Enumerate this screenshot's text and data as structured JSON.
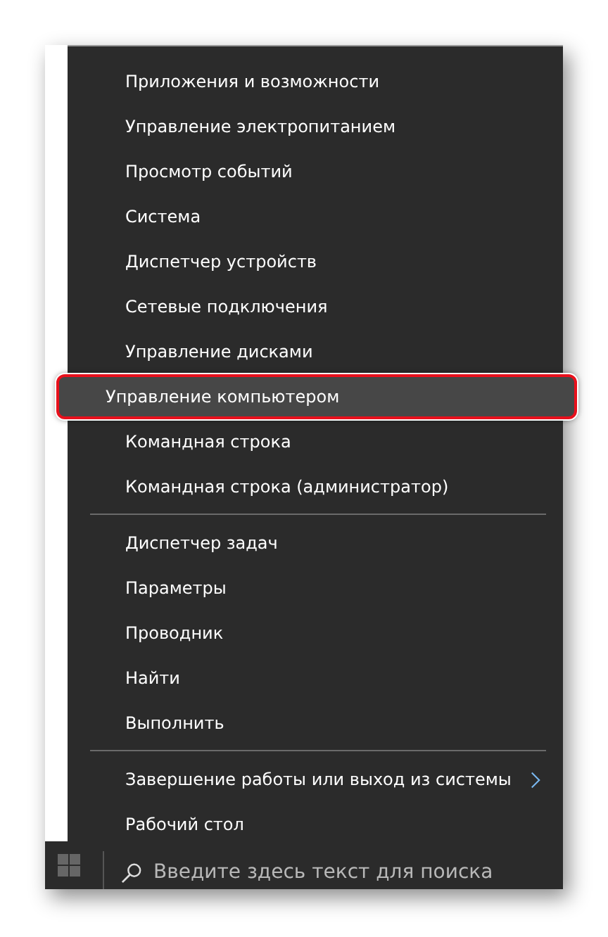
{
  "menu": {
    "groups": [
      {
        "items": [
          {
            "label": "Приложения и возможности",
            "selected": false,
            "has_submenu": false
          },
          {
            "label": "Управление электропитанием",
            "selected": false,
            "has_submenu": false
          },
          {
            "label": "Просмотр событий",
            "selected": false,
            "has_submenu": false
          },
          {
            "label": "Система",
            "selected": false,
            "has_submenu": false
          },
          {
            "label": "Диспетчер устройств",
            "selected": false,
            "has_submenu": false
          },
          {
            "label": "Сетевые подключения",
            "selected": false,
            "has_submenu": false
          },
          {
            "label": "Управление дисками",
            "selected": false,
            "has_submenu": false
          },
          {
            "label": "Управление компьютером",
            "selected": true,
            "has_submenu": false
          },
          {
            "label": "Командная строка",
            "selected": false,
            "has_submenu": false
          },
          {
            "label": "Командная строка (администратор)",
            "selected": false,
            "has_submenu": false
          }
        ]
      },
      {
        "items": [
          {
            "label": "Диспетчер задач",
            "selected": false,
            "has_submenu": false
          },
          {
            "label": "Параметры",
            "selected": false,
            "has_submenu": false
          },
          {
            "label": "Проводник",
            "selected": false,
            "has_submenu": false
          },
          {
            "label": "Найти",
            "selected": false,
            "has_submenu": false
          },
          {
            "label": "Выполнить",
            "selected": false,
            "has_submenu": false
          }
        ]
      },
      {
        "items": [
          {
            "label": "Завершение работы или выход из системы",
            "selected": false,
            "has_submenu": true
          },
          {
            "label": "Рабочий стол",
            "selected": false,
            "has_submenu": false
          }
        ]
      }
    ]
  },
  "taskbar": {
    "search": {
      "placeholder": "Введите здесь текст для поиска"
    }
  }
}
